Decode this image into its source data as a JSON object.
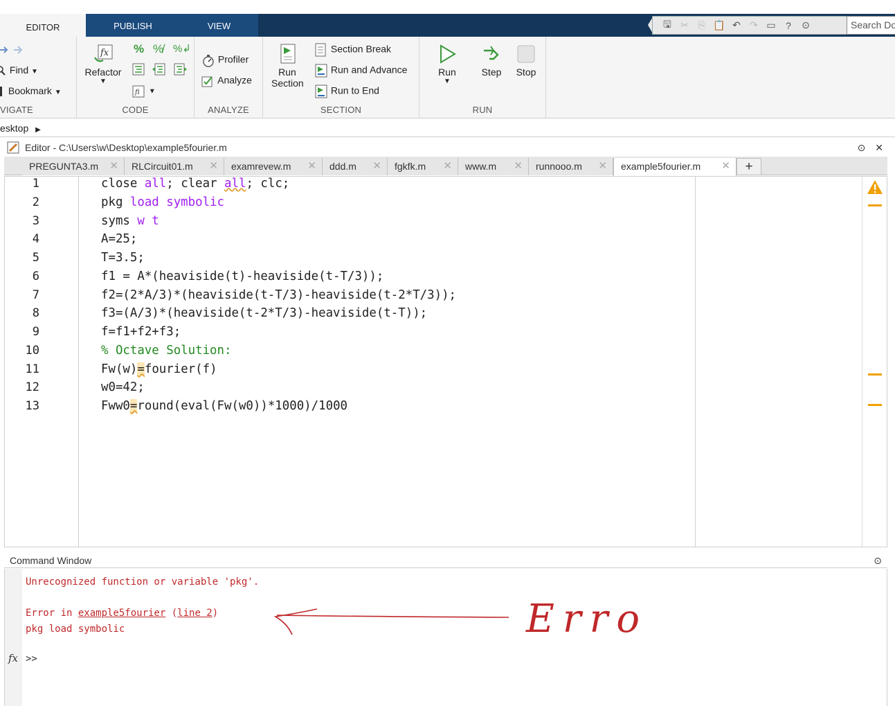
{
  "ribbon": {
    "tabs": [
      {
        "label": "EDITOR"
      },
      {
        "label": "PUBLISH"
      },
      {
        "label": "VIEW"
      }
    ],
    "search_placeholder": "Search Do",
    "navigate": {
      "find_label": "Find",
      "bookmark_label": "Bookmark",
      "section_label": "VIGATE"
    },
    "code": {
      "refactor_label": "Refactor",
      "section_label": "CODE"
    },
    "analyze": {
      "profiler_label": "Profiler",
      "analyze_label": "Analyze",
      "section_label": "ANALYZE"
    },
    "section": {
      "run_section_line1": "Run",
      "run_section_line2": "Section",
      "section_break_label": "Section Break",
      "run_advance_label": "Run and Advance",
      "run_end_label": "Run to End",
      "section_label": "SECTION"
    },
    "run": {
      "run_label": "Run",
      "step_label": "Step",
      "stop_label": "Stop",
      "section_label": "RUN"
    }
  },
  "address": {
    "path": "esktop"
  },
  "editor": {
    "title": "Editor - C:\\Users\\w\\Desktop\\example5fourier.m",
    "tabs": [
      {
        "label": "PREGUNTA3.m"
      },
      {
        "label": "RLCircuit01.m"
      },
      {
        "label": "examrevew.m"
      },
      {
        "label": "ddd.m"
      },
      {
        "label": "fgkfk.m"
      },
      {
        "label": "www.m"
      },
      {
        "label": "runnooo.m"
      },
      {
        "label": "example5fourier.m"
      }
    ],
    "add_tab": "+",
    "lines": [
      {
        "num": "1",
        "text": "close all; clear all; clc;"
      },
      {
        "num": "2",
        "text": "pkg load symbolic"
      },
      {
        "num": "3",
        "text": "syms w t"
      },
      {
        "num": "4",
        "text": "A=25;"
      },
      {
        "num": "5",
        "text": "T=3.5;"
      },
      {
        "num": "6",
        "text": "f1 = A*(heaviside(t)-heaviside(t-T/3));"
      },
      {
        "num": "7",
        "text": "f2=(2*A/3)*(heaviside(t-T/3)-heaviside(t-2*T/3));"
      },
      {
        "num": "8",
        "text": "f3=(A/3)*(heaviside(t-2*T/3)-heaviside(t-T));"
      },
      {
        "num": "9",
        "text": "f=f1+f2+f3;"
      },
      {
        "num": "10",
        "text": "% Octave Solution:"
      },
      {
        "num": "11",
        "text": "Fw(w)=fourier(f)"
      },
      {
        "num": "12",
        "text": "w0=42;"
      },
      {
        "num": "13",
        "text": "Fww0=round(eval(Fw(w0))*1000)/1000"
      }
    ]
  },
  "command_window": {
    "title": "Command Window",
    "error_message": "Unrecognized function or variable 'pkg'.",
    "error_prefix": "Error in ",
    "error_file": "example5fourier",
    "error_line": "line 2",
    "error_code": "pkg load symbolic",
    "prompt": ">>",
    "annotation": "Error"
  },
  "colors": {
    "tab_bar": "#13365a",
    "keyword": "#a020f0",
    "comment": "#228b22",
    "error": "#c0282a",
    "warning": "#f0a000"
  }
}
